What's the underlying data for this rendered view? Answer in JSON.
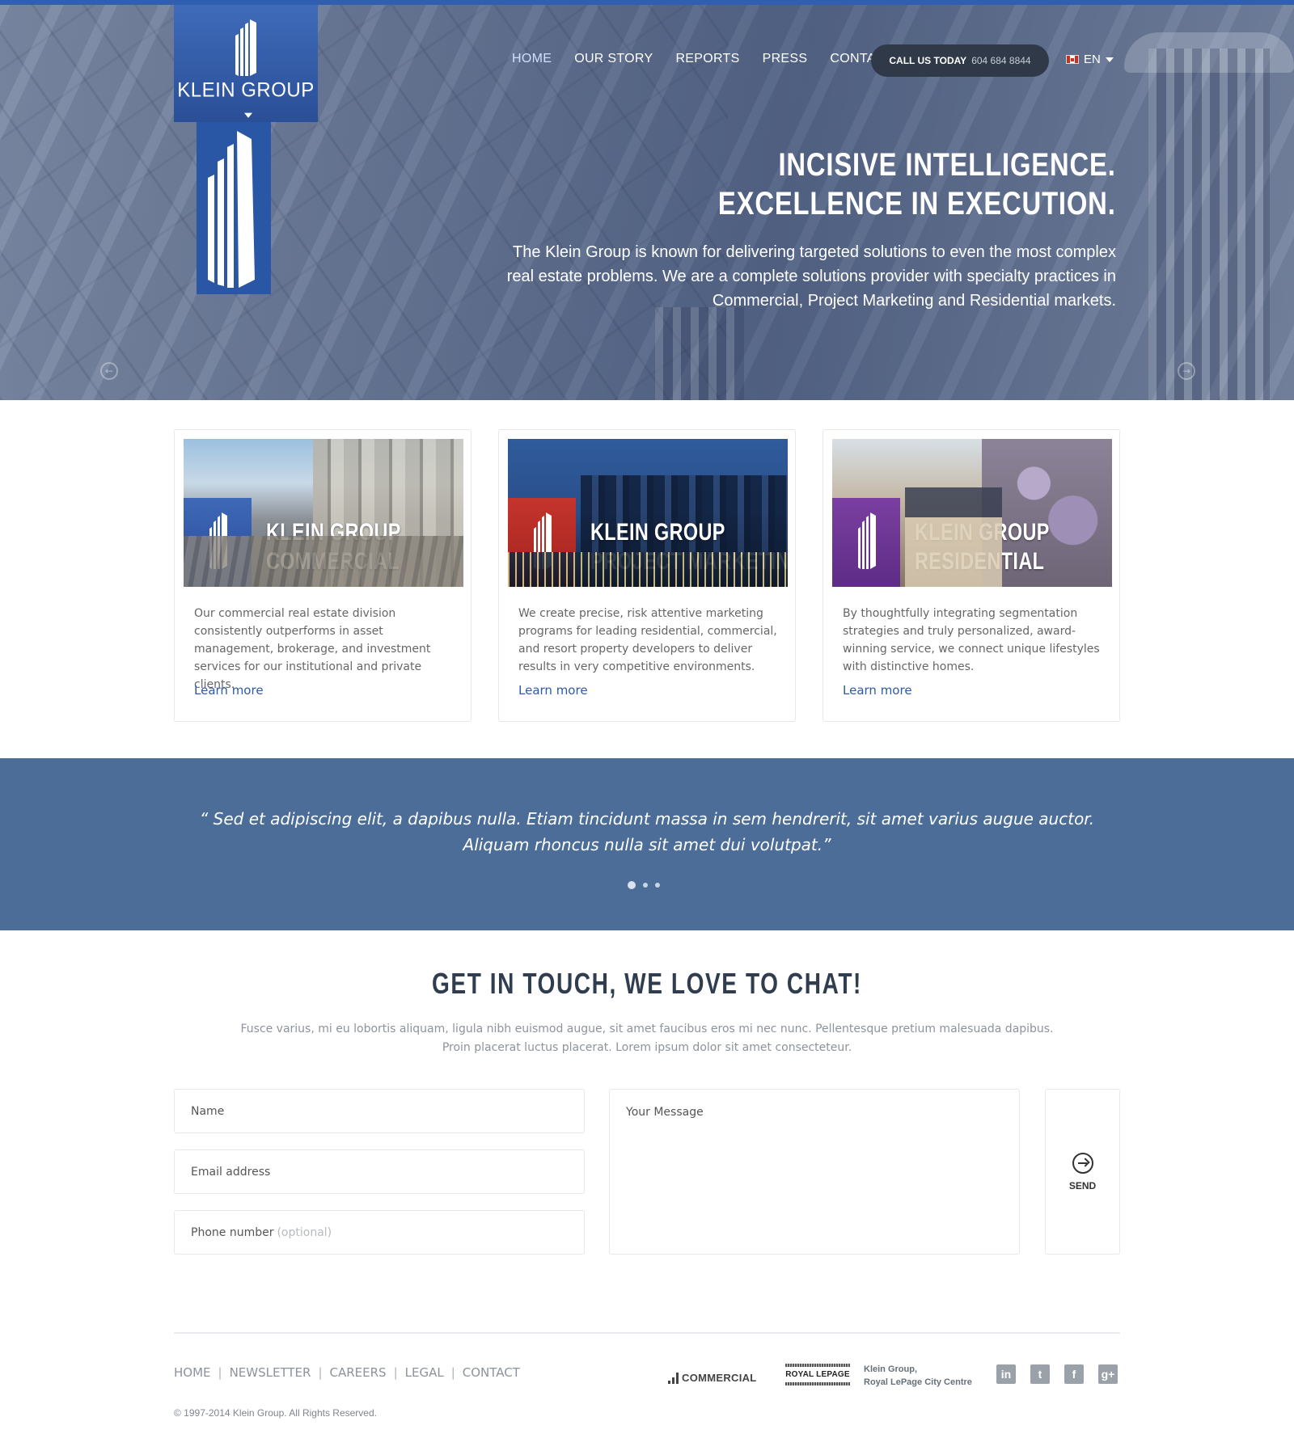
{
  "brand": {
    "name": "KLEIN GROUP"
  },
  "nav": {
    "items": [
      {
        "label": "HOME",
        "active": true
      },
      {
        "label": "OUR STORY",
        "active": false
      },
      {
        "label": "REPORTS",
        "active": false
      },
      {
        "label": "PRESS",
        "active": false
      },
      {
        "label": "CONTACT",
        "active": false
      }
    ],
    "call_label": "CALL US TODAY",
    "call_number": "604 684 8844",
    "language": "EN"
  },
  "hero": {
    "title_line1": "INCISIVE INTELLIGENCE.",
    "title_line2": "EXCELLENCE IN EXECUTION.",
    "text": "The Klein Group is known for delivering targeted solutions to even the most complex real estate problems. We are a complete solutions provider with specialty practices in Commercial, Project Marketing and Residential markets."
  },
  "cards": [
    {
      "title_line1": "KLEIN GROUP",
      "title_line2": "COMMERCIAL",
      "description": "Our commercial real estate division consistently outperforms in asset management, brokerage, and investment services for our institutional and private clients.",
      "link": "Learn more",
      "badge_color": "#2f5aa8"
    },
    {
      "title_line1": "KLEIN GROUP",
      "title_line2": "PROJECT MARKETING",
      "description": "We create precise, risk attentive marketing programs for leading residential, commercial, and resort property developers to deliver results in very competitive environments.",
      "link": "Learn more",
      "badge_color": "#b52c25"
    },
    {
      "title_line1": "KLEIN GROUP",
      "title_line2": "RESIDENTIAL",
      "description": "By thoughtfully integrating segmentation strategies and truly personalized, award-winning service, we connect unique lifestyles with distinctive homes.",
      "link": "Learn more",
      "badge_color": "#6b3494"
    }
  ],
  "testimonial": {
    "line1": "“ Sed et adipiscing elit, a dapibus nulla. Etiam tincidunt massa in sem hendrerit, sit amet varius augue auctor.",
    "line2": "Aliquam rhoncus nulla sit amet dui volutpat.”",
    "active_slide": 1,
    "slide_count": 3
  },
  "contact": {
    "title": "GET IN TOUCH, WE LOVE TO CHAT!",
    "subtitle_line1": "Fusce varius, mi eu lobortis aliquam, ligula nibh euismod augue, sit amet faucibus eros mi nec nunc. Pellentesque pretium malesuada dapibus.",
    "subtitle_line2": "Proin placerat luctus placerat. Lorem ipsum dolor sit amet consecteteur.",
    "name_placeholder": "Name",
    "email_placeholder": "Email address",
    "phone_placeholder": "Phone number",
    "phone_optional": "(optional)",
    "message_placeholder": "Your Message",
    "send_label": "SEND"
  },
  "footer": {
    "links": [
      "HOME",
      "NEWSLETTER",
      "CAREERS",
      "LEGAL",
      "CONTACT"
    ],
    "copyright": "© 1997-2014 Klein Group. All Rights Reserved.",
    "commercial_logo": "COMMERCIAL",
    "lepage_logo": "ROYAL LEPAGE",
    "klein_line1": "Klein Group,",
    "klein_line2": "Royal LePage City Centre",
    "socials": [
      {
        "icon": "linkedin-icon",
        "glyph": "in"
      },
      {
        "icon": "twitter-icon",
        "glyph": "t"
      },
      {
        "icon": "facebook-icon",
        "glyph": "f"
      },
      {
        "icon": "google-plus-icon",
        "glyph": "g+"
      }
    ]
  },
  "colors": {
    "accent": "#2f5fae",
    "quote_band": "#4b6d97",
    "link": "#2e5aa6",
    "title": "#2f3d4f"
  }
}
